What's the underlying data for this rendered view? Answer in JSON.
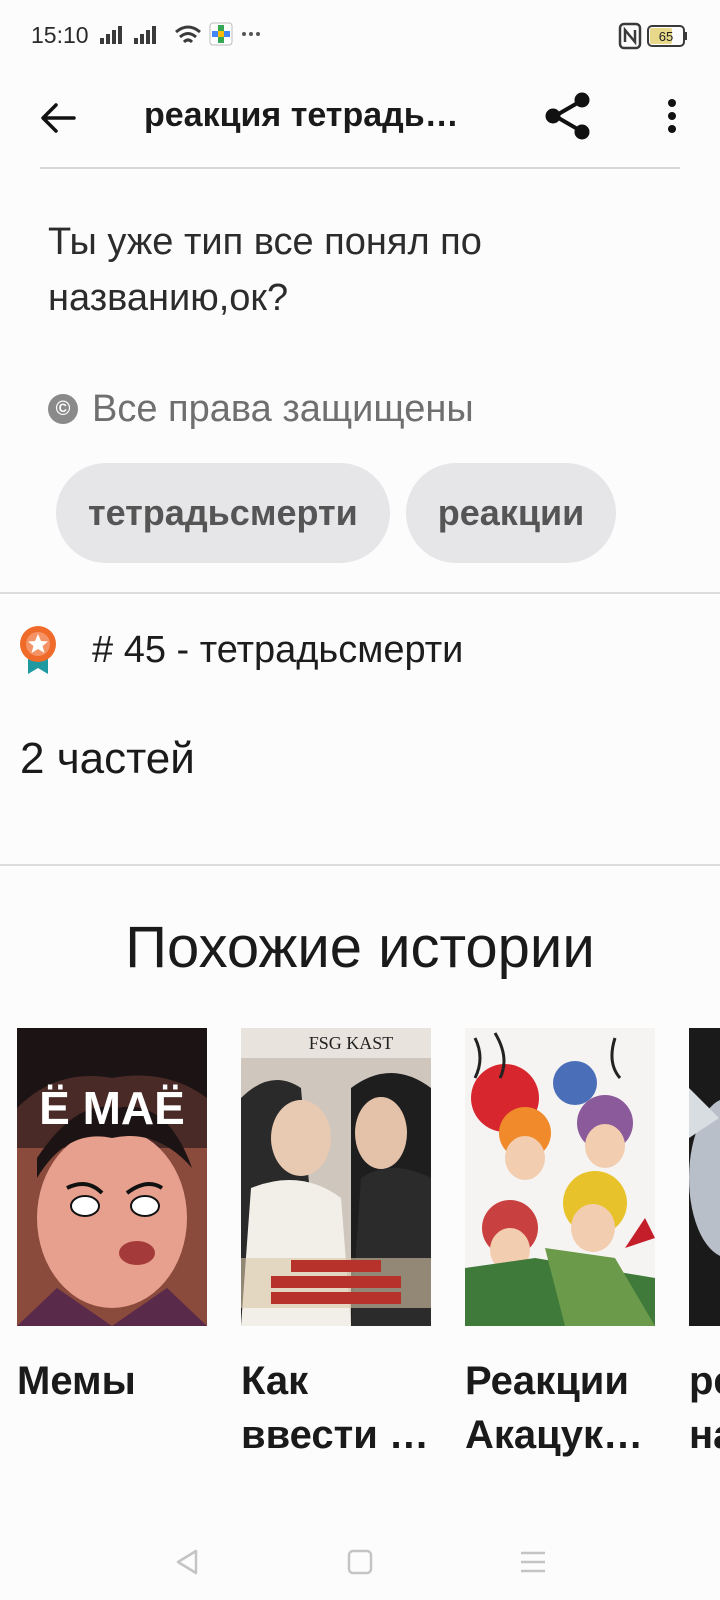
{
  "status_bar": {
    "time": "15:10",
    "battery": "65"
  },
  "app_bar": {
    "title": "реакция тетрадь…"
  },
  "description": {
    "line1": "Ты уже тип все понял по",
    "line2": "названию,ок?"
  },
  "copyright": {
    "icon_glyph": "©",
    "text": "Все права защищены"
  },
  "tags": [
    "тетрадьсмерти",
    "реакции"
  ],
  "ranking": {
    "text": "# 45 - тетрадьсмерти"
  },
  "parts": {
    "text": "2 частей"
  },
  "similar": {
    "title": "Похожие истории",
    "stories": [
      {
        "line1": "Мемы",
        "line2": "",
        "cover_caption": "Ё МАЁ"
      },
      {
        "line1": "Как",
        "line2": "ввести …",
        "cover_caption": "FSG KAST"
      },
      {
        "line1": "Реакции",
        "line2": "Акацук…",
        "cover_caption": ""
      },
      {
        "line1": "ре",
        "line2": "на",
        "cover_caption": ""
      }
    ]
  },
  "colors": {
    "background": "#fdfcfd",
    "tag_bg": "#e6e5e7",
    "rank_badge": "#f06a2a",
    "rank_ribbon": "#1f9aa0"
  }
}
